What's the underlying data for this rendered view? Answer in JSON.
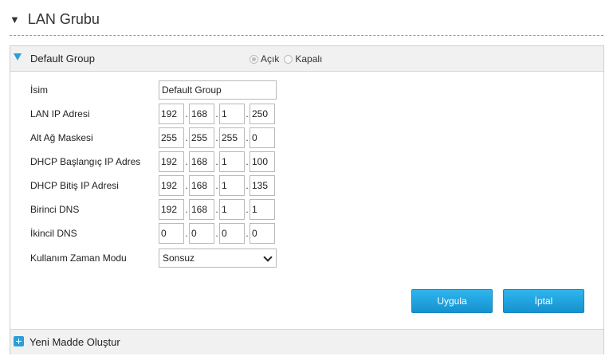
{
  "section": {
    "title": "LAN Grubu"
  },
  "group": {
    "title": "Default Group",
    "toggle": {
      "on_label": "Açık",
      "off_label": "Kapalı",
      "selected": "Açık"
    }
  },
  "form": {
    "name": {
      "label": "İsim",
      "value": "Default Group"
    },
    "lan_ip": {
      "label": "LAN IP Adresi",
      "octets": [
        "192",
        "168",
        "1",
        "250"
      ]
    },
    "subnet": {
      "label": "Alt Ağ Maskesi",
      "octets": [
        "255",
        "255",
        "255",
        "0"
      ]
    },
    "dhcp_start": {
      "label": "DHCP Başlangıç IP Adres",
      "octets": [
        "192",
        "168",
        "1",
        "100"
      ]
    },
    "dhcp_end": {
      "label": "DHCP Bitiş IP Adresi",
      "octets": [
        "192",
        "168",
        "1",
        "135"
      ]
    },
    "dns1": {
      "label": "Birinci DNS",
      "octets": [
        "192",
        "168",
        "1",
        "1"
      ]
    },
    "dns2": {
      "label": "İkincil DNS",
      "octets": [
        "0",
        "0",
        "0",
        "0"
      ]
    },
    "lease_mode": {
      "label": "Kullanım Zaman Modu",
      "value": "Sonsuz"
    }
  },
  "buttons": {
    "apply": "Uygula",
    "cancel": "İptal"
  },
  "footer": {
    "new_item": "Yeni Madde Oluştur"
  },
  "colors": {
    "accent": "#2a9fd8",
    "button": "#1b9ddc"
  }
}
